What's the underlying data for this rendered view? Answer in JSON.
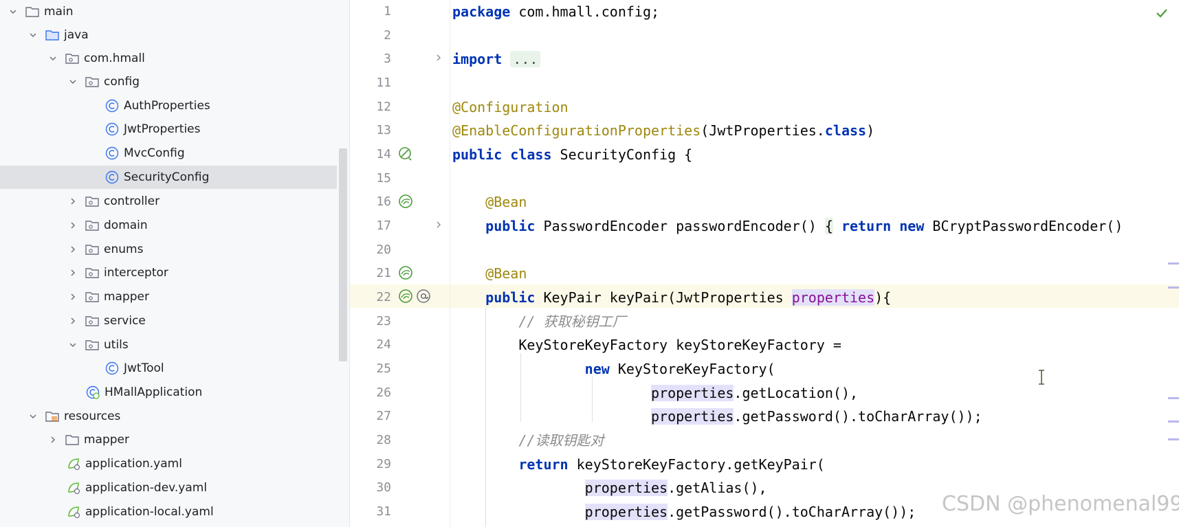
{
  "project_tree": {
    "items": [
      {
        "label": "main",
        "icon": "folder-icon",
        "expanded": true
      },
      {
        "label": "java",
        "icon": "source-folder-icon",
        "expanded": true
      },
      {
        "label": "com.hmall",
        "icon": "package-icon",
        "expanded": true
      },
      {
        "label": "config",
        "icon": "package-icon",
        "expanded": true
      },
      {
        "label": "AuthProperties",
        "icon": "class-icon"
      },
      {
        "label": "JwtProperties",
        "icon": "class-icon"
      },
      {
        "label": "MvcConfig",
        "icon": "class-icon"
      },
      {
        "label": "SecurityConfig",
        "icon": "class-icon",
        "selected": true
      },
      {
        "label": "controller",
        "icon": "package-icon",
        "expanded": false
      },
      {
        "label": "domain",
        "icon": "package-icon",
        "expanded": false
      },
      {
        "label": "enums",
        "icon": "package-icon",
        "expanded": false
      },
      {
        "label": "interceptor",
        "icon": "package-icon",
        "expanded": false
      },
      {
        "label": "mapper",
        "icon": "package-icon",
        "expanded": false
      },
      {
        "label": "service",
        "icon": "package-icon",
        "expanded": false
      },
      {
        "label": "utils",
        "icon": "package-icon",
        "expanded": true
      },
      {
        "label": "JwtTool",
        "icon": "class-icon"
      },
      {
        "label": "HMallApplication",
        "icon": "spring-boot-class-icon"
      },
      {
        "label": "resources",
        "icon": "resources-folder-icon",
        "expanded": true
      },
      {
        "label": "mapper",
        "icon": "folder-icon",
        "expanded": false
      },
      {
        "label": "application.yaml",
        "icon": "spring-yaml-icon"
      },
      {
        "label": "application-dev.yaml",
        "icon": "spring-yaml-icon"
      },
      {
        "label": "application-local.yaml",
        "icon": "spring-yaml-icon"
      }
    ]
  },
  "editor": {
    "lines": [
      {
        "n": "1",
        "text": "package com.hmall.config;"
      },
      {
        "n": "2",
        "text": ""
      },
      {
        "n": "3",
        "text": "import ..."
      },
      {
        "n": "11",
        "text": ""
      },
      {
        "n": "12",
        "text": "@Configuration"
      },
      {
        "n": "13",
        "text": "@EnableConfigurationProperties(JwtProperties.class)"
      },
      {
        "n": "14",
        "text": "public class SecurityConfig {"
      },
      {
        "n": "15",
        "text": ""
      },
      {
        "n": "16",
        "text": "    @Bean"
      },
      {
        "n": "17",
        "text": "    public PasswordEncoder passwordEncoder() { return new BCryptPasswordEncoder()"
      },
      {
        "n": "20",
        "text": ""
      },
      {
        "n": "21",
        "text": "    @Bean"
      },
      {
        "n": "22",
        "text": "    public KeyPair keyPair(JwtProperties properties){"
      },
      {
        "n": "23",
        "text": "        // 获取秘钥工厂"
      },
      {
        "n": "24",
        "text": "        KeyStoreKeyFactory keyStoreKeyFactory ="
      },
      {
        "n": "25",
        "text": "                new KeyStoreKeyFactory("
      },
      {
        "n": "26",
        "text": "                        properties.getLocation(),"
      },
      {
        "n": "27",
        "text": "                        properties.getPassword().toCharArray());"
      },
      {
        "n": "28",
        "text": "        //读取钥匙对"
      },
      {
        "n": "29",
        "text": "        return keyStoreKeyFactory.getKeyPair("
      },
      {
        "n": "30",
        "text": "                properties.getAlias(),"
      },
      {
        "n": "31",
        "text": "                properties.getPassword().toCharArray());"
      }
    ],
    "current_line": "22",
    "gutter_icons": [
      {
        "line": "14",
        "icon": "bean-no-autowire-icon"
      },
      {
        "line": "16",
        "icon": "bean-method-icon"
      },
      {
        "line": "21",
        "icon": "bean-method-icon"
      },
      {
        "line": "22",
        "icon": "bean-method-icon"
      },
      {
        "line": "22",
        "icon": "at-annotation-icon"
      }
    ],
    "fold_lines": [
      "3",
      "17"
    ],
    "inspection_status": "check-icon"
  },
  "watermark": "CSDN @phenomenal99",
  "colors": {
    "keyword": "#0033b3",
    "annotation": "#9e880d",
    "comment": "#8c8c8c",
    "param_highlight": "#e3e1fa",
    "current_line": "#fdf9e8",
    "selected_tree_row": "#dfe1e5"
  }
}
